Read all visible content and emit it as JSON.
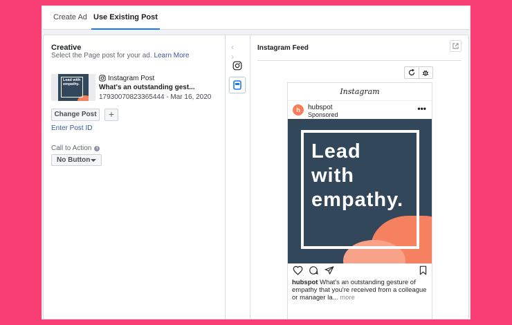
{
  "tabs": [
    {
      "label": "Create Ad",
      "active": false
    },
    {
      "label": "Use Existing Post",
      "active": true
    }
  ],
  "creative": {
    "title": "Creative",
    "subtitle": "Select the Page post for your ad.",
    "learn_more": "Learn More",
    "post": {
      "thumb_text": "Lead with empathy.",
      "type_label": "Instagram Post",
      "title": "What's an outstanding gest...",
      "id_date": "17930070823365444 - Mar 16, 2020"
    },
    "change_post_label": "Change Post",
    "add_label": "+",
    "enter_post_id": "Enter Post ID",
    "cta": {
      "label": "Call to Action",
      "info_icon": "i",
      "selected": "No Button"
    }
  },
  "preview": {
    "placement_title": "Instagram Feed",
    "nav_arrows": "‹ ›",
    "phone": {
      "app_name": "Instagram",
      "account": "hubspot",
      "account_initial": "h",
      "sponsored": "Sponsored",
      "more": "•••",
      "creative_lines": [
        "Lead",
        "with",
        "empathy."
      ],
      "caption_user": "hubspot",
      "caption_text": "What's an outstanding gesture of empathy that you're received from a colleague or manager la...",
      "caption_more": "more"
    }
  },
  "colors": {
    "background": "#f93d75",
    "accent": "#1877f2",
    "creative_bg": "#33475b",
    "creative_blob": "#f58160",
    "hubspot": "#ff7a59"
  },
  "icons": [
    "instagram-icon",
    "mobile-feed-icon",
    "refresh-icon",
    "bug-icon",
    "external-link-icon",
    "heart-icon",
    "comment-icon",
    "share-icon",
    "bookmark-icon"
  ]
}
